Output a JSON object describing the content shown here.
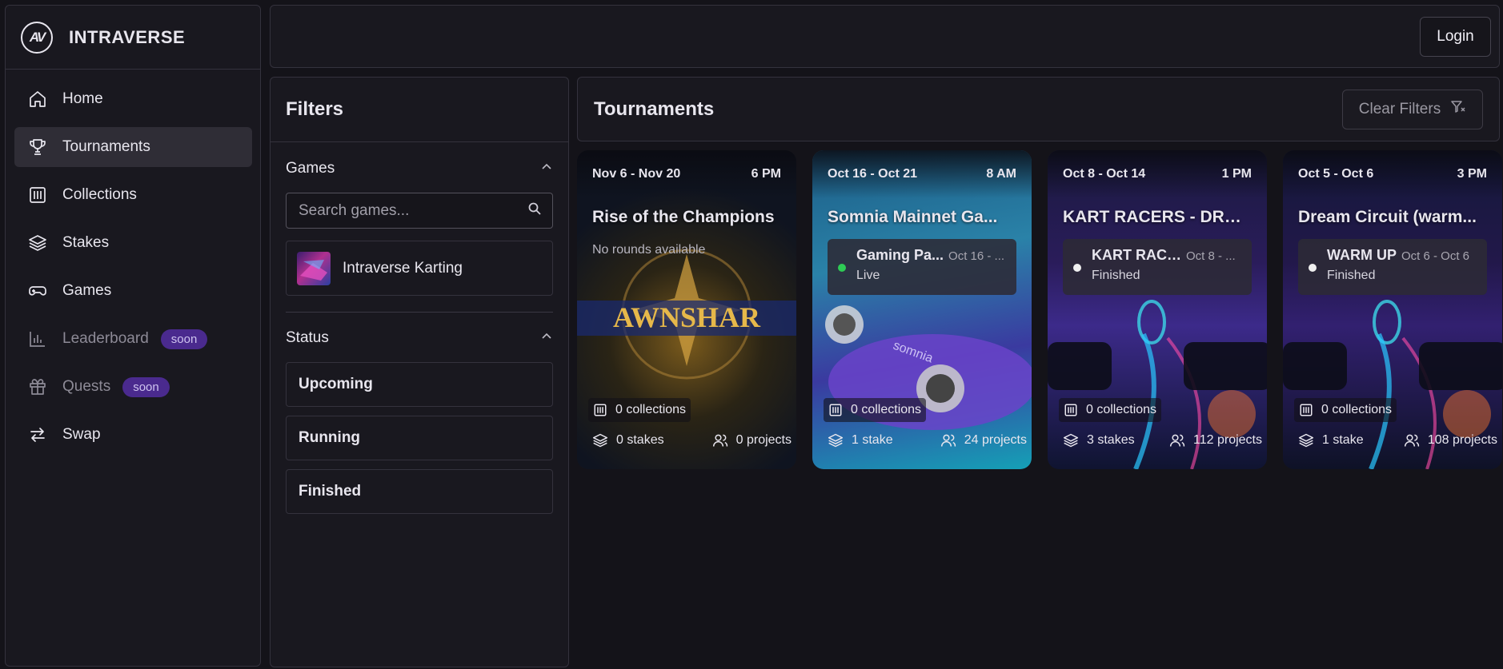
{
  "brand": {
    "logo_text": "AV",
    "name": "INTRAVERSE"
  },
  "nav": [
    {
      "label": "Home",
      "icon": "home-icon",
      "active": false,
      "badge": ""
    },
    {
      "label": "Tournaments",
      "icon": "trophy-icon",
      "active": true,
      "badge": ""
    },
    {
      "label": "Collections",
      "icon": "collections-icon",
      "active": false,
      "badge": ""
    },
    {
      "label": "Stakes",
      "icon": "layers-icon",
      "active": false,
      "badge": ""
    },
    {
      "label": "Games",
      "icon": "gamepad-icon",
      "active": false,
      "badge": ""
    },
    {
      "label": "Leaderboard",
      "icon": "bar-chart-icon",
      "active": false,
      "badge": "soon"
    },
    {
      "label": "Quests",
      "icon": "gift-icon",
      "active": false,
      "badge": "soon"
    },
    {
      "label": "Swap",
      "icon": "swap-icon",
      "active": false,
      "badge": ""
    }
  ],
  "topbar": {
    "login_label": "Login"
  },
  "filters": {
    "title": "Filters",
    "games_label": "Games",
    "search_placeholder": "Search games...",
    "game_item": "Intraverse Karting",
    "status_label": "Status",
    "statuses": [
      "Upcoming",
      "Running",
      "Finished"
    ]
  },
  "tournaments": {
    "title": "Tournaments",
    "clear_label": "Clear Filters",
    "cards": [
      {
        "dates": "Nov 6 - Nov 20",
        "time": "6 PM",
        "title": "Rise of the Champions",
        "no_rounds": "No rounds available",
        "collections": "0 collections",
        "stakes": "0 stakes",
        "projects": "0 projects"
      },
      {
        "dates": "Oct 16 - Oct 21",
        "time": "8 AM",
        "title": "Somnia Mainnet Ga...",
        "round": {
          "name": "Gaming Pa...",
          "date": "Oct 16 - ...",
          "status": "Live",
          "dot_color": "#2ecc55"
        },
        "collections": "0 collections",
        "stakes": "1 stake",
        "projects": "24 projects"
      },
      {
        "dates": "Oct 8 - Oct 14",
        "time": "1 PM",
        "title": "KART RACERS - DREA...",
        "round": {
          "name": "KART RACER...",
          "date": "Oct 8 - ...",
          "status": "Finished",
          "dot_color": "#f0f0f0"
        },
        "collections": "0 collections",
        "stakes": "3 stakes",
        "projects": "112 projects"
      },
      {
        "dates": "Oct 5 - Oct 6",
        "time": "3 PM",
        "title": "Dream Circuit (warm...",
        "round": {
          "name": "WARM UP",
          "date": "Oct 6 - Oct 6",
          "status": "Finished",
          "dot_color": "#f0f0f0"
        },
        "collections": "0 collections",
        "stakes": "1 stake",
        "projects": "108 projects"
      }
    ]
  }
}
